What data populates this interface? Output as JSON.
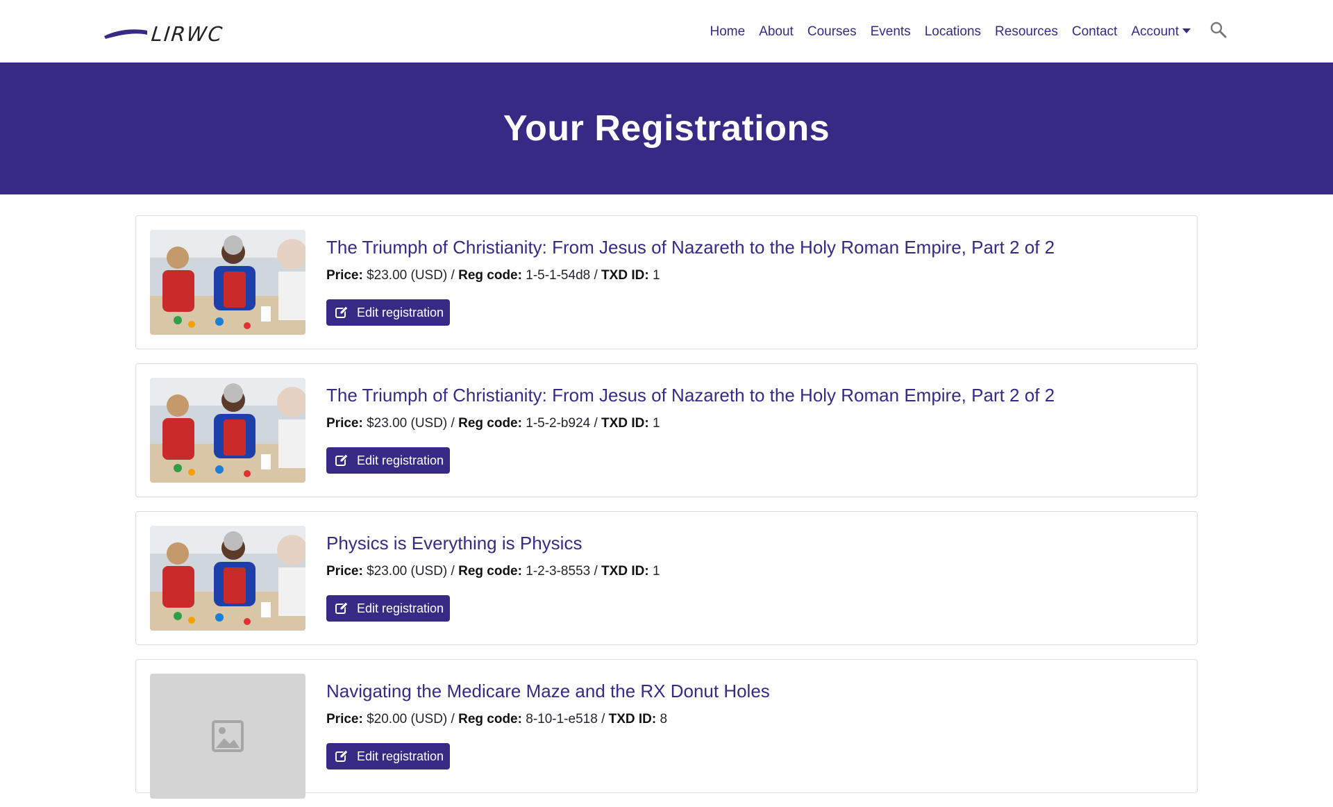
{
  "brand": {
    "name": "LIRWC"
  },
  "nav": {
    "items": [
      "Home",
      "About",
      "Courses",
      "Events",
      "Locations",
      "Resources",
      "Contact"
    ],
    "account_label": "Account",
    "search_icon": "search-icon"
  },
  "hero": {
    "title": "Your Registrations"
  },
  "labels": {
    "price": "Price:",
    "reg_code": "Reg code:",
    "txd_id": "TXD ID:",
    "sep": "/"
  },
  "registrations": [
    {
      "title": "The Triumph of Christianity: From Jesus of Nazareth to the Holy Roman Empire, Part 2 of 2",
      "price": "$23.00 (USD)",
      "reg_code": "1-5-1-54d8",
      "txd_id": "1",
      "button": "Edit registration",
      "image": "photo"
    },
    {
      "title": "The Triumph of Christianity: From Jesus of Nazareth to the Holy Roman Empire, Part 2 of 2",
      "price": "$23.00 (USD)",
      "reg_code": "1-5-2-b924",
      "txd_id": "1",
      "button": "Edit registration",
      "image": "photo"
    },
    {
      "title": "Physics is Everything is Physics",
      "price": "$23.00 (USD)",
      "reg_code": "1-2-3-8553",
      "txd_id": "1",
      "button": "Edit registration",
      "image": "photo"
    },
    {
      "title": "Navigating the Medicare Maze and the RX Donut Holes",
      "price": "$20.00 (USD)",
      "reg_code": "8-10-1-e518",
      "txd_id": "8",
      "button": "Edit registration",
      "image": "placeholder"
    }
  ],
  "colors": {
    "brand": "#372a85",
    "border": "#dcdcdc",
    "placeholder": "#d4d4d4"
  }
}
